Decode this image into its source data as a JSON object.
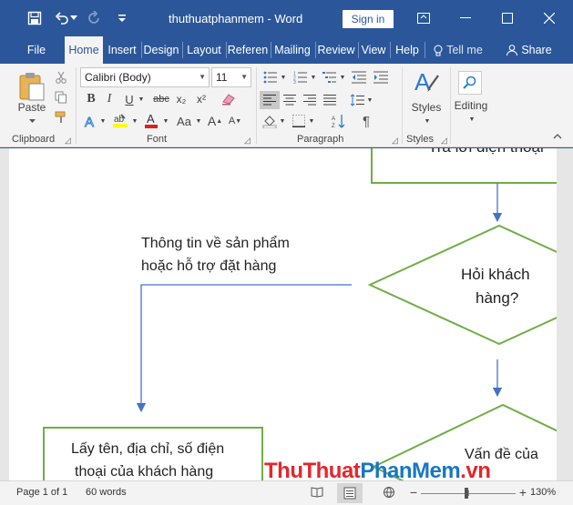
{
  "titlebar": {
    "doc_title": "thuthuatphanmem",
    "app_name": "Word",
    "separator": "-",
    "signin_label": "Sign in"
  },
  "tabs": [
    {
      "label": "File"
    },
    {
      "label": "Home"
    },
    {
      "label": "Insert"
    },
    {
      "label": "Design"
    },
    {
      "label": "Layout"
    },
    {
      "label": "Referen"
    },
    {
      "label": "Mailing"
    },
    {
      "label": "Review"
    },
    {
      "label": "View"
    },
    {
      "label": "Help"
    },
    {
      "label": "Tell me"
    },
    {
      "label": "Share"
    }
  ],
  "ribbon": {
    "clipboard": {
      "label": "Clipboard",
      "paste_label": "Paste"
    },
    "font": {
      "label": "Font",
      "font_name": "Calibri (Body)",
      "font_size": "11",
      "change_case": "Aa"
    },
    "paragraph": {
      "label": "Paragraph"
    },
    "styles": {
      "label": "Styles",
      "styles_label": "Styles"
    },
    "editing": {
      "label": "Editing"
    }
  },
  "document": {
    "box_top_text": "Trả lời điện thoại",
    "info_line1": "Thông tin về sản phẩm",
    "info_line2": "hoặc hỗ trợ đặt hàng",
    "diamond1_line1": "Hỏi khách",
    "diamond1_line2": "hàng?",
    "box_bottom_line1": "Lấy tên, địa chỉ, số điện",
    "box_bottom_line2": "thoại của khách hàng",
    "diamond2_line1": "Vấn đề của"
  },
  "statusbar": {
    "page": "Page 1 of 1",
    "words": "60 words",
    "zoom": "130%"
  },
  "watermark": {
    "part1": "ThuThuat",
    "part2": "PhanMem",
    "part3": ".vn"
  },
  "colors": {
    "word_blue": "#2b579a",
    "shape_green": "#70ad47",
    "arrow_blue": "#4472c4",
    "watermark_red": "#e3262b",
    "watermark_blue": "#1877c2"
  }
}
